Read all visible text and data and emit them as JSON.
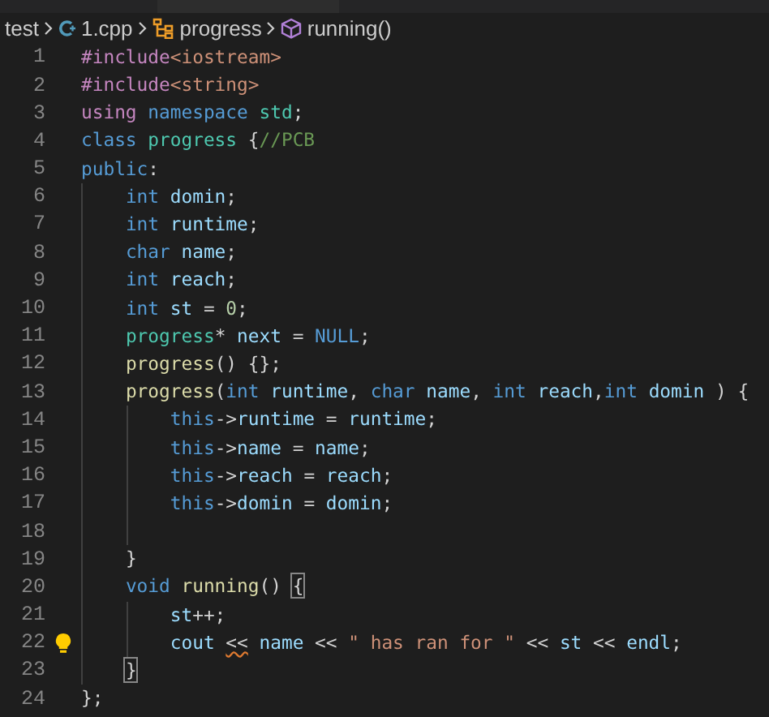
{
  "breadcrumbs": [
    {
      "text": "test",
      "kind": "folder"
    },
    {
      "text": "1.cpp",
      "kind": "cpp_file"
    },
    {
      "text": "progress",
      "kind": "class"
    },
    {
      "text": "running()",
      "kind": "method"
    }
  ],
  "lines": [
    {
      "number": "1",
      "tokens": [
        {
          "text": "#include",
          "kind": "directive"
        },
        {
          "text": "<iostream>",
          "kind": "string"
        }
      ]
    },
    {
      "number": "2",
      "tokens": [
        {
          "text": "#include",
          "kind": "directive"
        },
        {
          "text": "<string>",
          "kind": "string"
        }
      ]
    },
    {
      "number": "3",
      "tokens": [
        {
          "text": "using",
          "kind": "control"
        },
        {
          "text": " namespace",
          "kind": "keyword"
        },
        {
          "text": " std",
          "kind": "type"
        },
        {
          "text": ";",
          "kind": "plain"
        }
      ]
    },
    {
      "number": "4",
      "tokens": [
        {
          "text": "class",
          "kind": "keyword"
        },
        {
          "text": " progress",
          "kind": "type"
        },
        {
          "text": " {",
          "kind": "plain"
        },
        {
          "text": "//PCB",
          "kind": "comment"
        }
      ]
    },
    {
      "number": "5",
      "tokens": [
        {
          "text": "public",
          "kind": "keyword"
        },
        {
          "text": ":",
          "kind": "plain"
        }
      ]
    },
    {
      "number": "6",
      "tokens": [
        {
          "text": "    int",
          "kind": "keyword"
        },
        {
          "text": " domin",
          "kind": "variable"
        },
        {
          "text": ";",
          "kind": "plain"
        }
      ]
    },
    {
      "number": "7",
      "tokens": [
        {
          "text": "    int",
          "kind": "keyword"
        },
        {
          "text": " runtime",
          "kind": "variable"
        },
        {
          "text": ";",
          "kind": "plain"
        }
      ]
    },
    {
      "number": "8",
      "tokens": [
        {
          "text": "    char",
          "kind": "keyword"
        },
        {
          "text": " name",
          "kind": "variable"
        },
        {
          "text": ";",
          "kind": "plain"
        }
      ]
    },
    {
      "number": "9",
      "tokens": [
        {
          "text": "    int",
          "kind": "keyword"
        },
        {
          "text": " reach",
          "kind": "variable"
        },
        {
          "text": ";",
          "kind": "plain"
        }
      ]
    },
    {
      "number": "10",
      "tokens": [
        {
          "text": "    int",
          "kind": "keyword"
        },
        {
          "text": " st",
          "kind": "variable"
        },
        {
          "text": " = ",
          "kind": "plain"
        },
        {
          "text": "0",
          "kind": "number"
        },
        {
          "text": ";",
          "kind": "plain"
        }
      ]
    },
    {
      "number": "11",
      "tokens": [
        {
          "text": "    progress",
          "kind": "type"
        },
        {
          "text": "* ",
          "kind": "plain"
        },
        {
          "text": "next",
          "kind": "variable"
        },
        {
          "text": " = ",
          "kind": "plain"
        },
        {
          "text": "NULL",
          "kind": "keyword"
        },
        {
          "text": ";",
          "kind": "plain"
        }
      ]
    },
    {
      "number": "12",
      "tokens": [
        {
          "text": "    progress",
          "kind": "function"
        },
        {
          "text": "() {};",
          "kind": "plain"
        }
      ]
    },
    {
      "number": "13",
      "tokens": [
        {
          "text": "    progress",
          "kind": "function"
        },
        {
          "text": "(",
          "kind": "plain"
        },
        {
          "text": "int",
          "kind": "keyword"
        },
        {
          "text": " runtime",
          "kind": "variable"
        },
        {
          "text": ", ",
          "kind": "plain"
        },
        {
          "text": "char",
          "kind": "keyword"
        },
        {
          "text": " name",
          "kind": "variable"
        },
        {
          "text": ", ",
          "kind": "plain"
        },
        {
          "text": "int",
          "kind": "keyword"
        },
        {
          "text": " reach",
          "kind": "variable"
        },
        {
          "text": ",",
          "kind": "plain"
        },
        {
          "text": "int",
          "kind": "keyword"
        },
        {
          "text": " domin",
          "kind": "variable"
        },
        {
          "text": " ) {",
          "kind": "plain"
        }
      ]
    },
    {
      "number": "14",
      "tokens": [
        {
          "text": "        this",
          "kind": "keyword"
        },
        {
          "text": "->",
          "kind": "plain"
        },
        {
          "text": "runtime",
          "kind": "variable"
        },
        {
          "text": " = ",
          "kind": "plain"
        },
        {
          "text": "runtime",
          "kind": "variable"
        },
        {
          "text": ";",
          "kind": "plain"
        }
      ]
    },
    {
      "number": "15",
      "tokens": [
        {
          "text": "        this",
          "kind": "keyword"
        },
        {
          "text": "->",
          "kind": "plain"
        },
        {
          "text": "name",
          "kind": "variable"
        },
        {
          "text": " = ",
          "kind": "plain"
        },
        {
          "text": "name",
          "kind": "variable"
        },
        {
          "text": ";",
          "kind": "plain"
        }
      ]
    },
    {
      "number": "16",
      "tokens": [
        {
          "text": "        this",
          "kind": "keyword"
        },
        {
          "text": "->",
          "kind": "plain"
        },
        {
          "text": "reach",
          "kind": "variable"
        },
        {
          "text": " = ",
          "kind": "plain"
        },
        {
          "text": "reach",
          "kind": "variable"
        },
        {
          "text": ";",
          "kind": "plain"
        }
      ]
    },
    {
      "number": "17",
      "tokens": [
        {
          "text": "        this",
          "kind": "keyword"
        },
        {
          "text": "->",
          "kind": "plain"
        },
        {
          "text": "domin",
          "kind": "variable"
        },
        {
          "text": " = ",
          "kind": "plain"
        },
        {
          "text": "domin",
          "kind": "variable"
        },
        {
          "text": ";",
          "kind": "plain"
        }
      ]
    },
    {
      "number": "18"
    },
    {
      "number": "19",
      "tokens": [
        {
          "text": "    }",
          "kind": "plain"
        }
      ]
    },
    {
      "number": "20",
      "tokens": [
        {
          "text": "    void",
          "kind": "keyword"
        },
        {
          "text": " running",
          "kind": "function"
        },
        {
          "text": "() ",
          "kind": "plain"
        },
        {
          "text": "{",
          "kind": "bracket_match"
        }
      ]
    },
    {
      "number": "21",
      "tokens": [
        {
          "text": "        st",
          "kind": "variable"
        },
        {
          "text": "++;",
          "kind": "plain"
        }
      ]
    },
    {
      "number": "22",
      "lightbulb": true,
      "tokens": [
        {
          "text": "        cout ",
          "kind": "variable"
        },
        {
          "text": "<<",
          "kind": "error"
        },
        {
          "text": " name",
          "kind": "variable"
        },
        {
          "text": " << ",
          "kind": "plain"
        },
        {
          "text": "\" has ran for \"",
          "kind": "string"
        },
        {
          "text": " << ",
          "kind": "plain"
        },
        {
          "text": "st",
          "kind": "variable"
        },
        {
          "text": " << ",
          "kind": "plain"
        },
        {
          "text": "endl",
          "kind": "variable"
        },
        {
          "text": ";",
          "kind": "plain"
        }
      ]
    },
    {
      "number": "23",
      "tokens": [
        {
          "text": "    }",
          "kind": "bracket_match"
        }
      ]
    },
    {
      "number": "24",
      "tokens": [
        {
          "text": "};",
          "kind": "plain"
        }
      ]
    }
  ]
}
